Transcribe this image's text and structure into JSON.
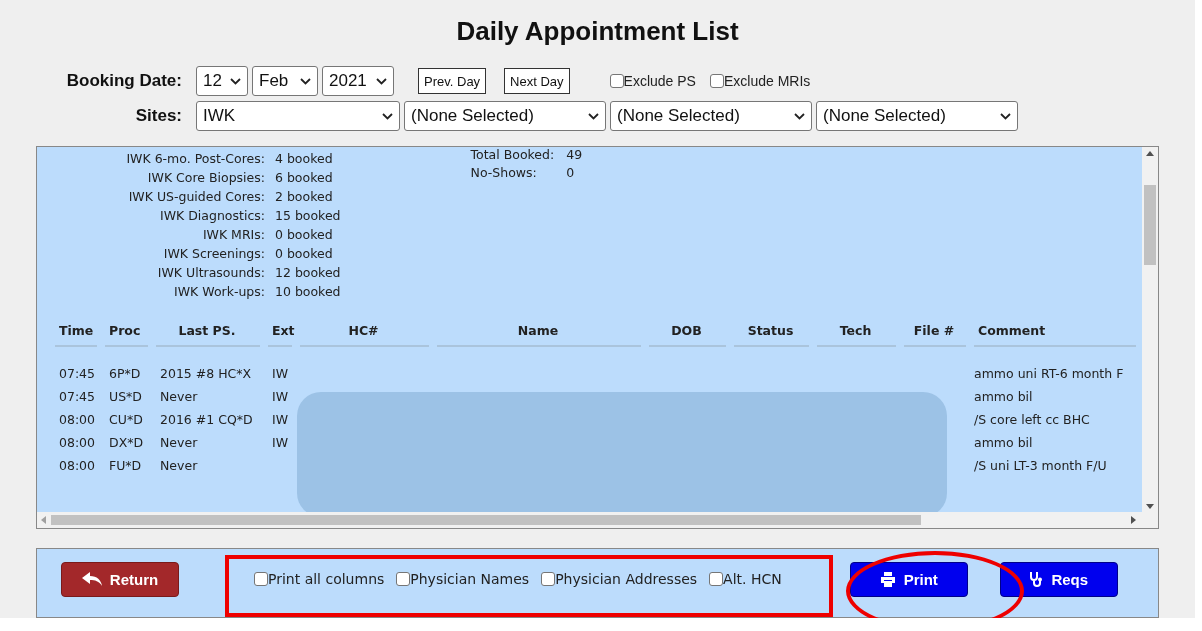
{
  "title": "Daily Appointment List",
  "booking_date": {
    "label": "Booking Date:",
    "day": "12",
    "month": "Feb",
    "year": "2021"
  },
  "day_buttons": [
    "Prev. Day",
    "Next Day"
  ],
  "filters": [
    {
      "label": "Exclude PS",
      "checked": false
    },
    {
      "label": "Exclude MRIs",
      "checked": false
    }
  ],
  "sites": {
    "label": "Sites:",
    "selects": [
      "IWK",
      "(None Selected)",
      "(None Selected)",
      "(None Selected)"
    ]
  },
  "summary": [
    {
      "label": "IWK 6-mo. Post-Cores:",
      "value": "4 booked"
    },
    {
      "label": "IWK Core Biopsies:",
      "value": "6 booked"
    },
    {
      "label": "IWK US-guided Cores:",
      "value": "2 booked"
    },
    {
      "label": "IWK Diagnostics:",
      "value": "15 booked"
    },
    {
      "label": "IWK MRIs:",
      "value": "0 booked"
    },
    {
      "label": "IWK Screenings:",
      "value": "0 booked"
    },
    {
      "label": "IWK Ultrasounds:",
      "value": "12 booked"
    },
    {
      "label": "IWK Work-ups:",
      "value": "10 booked"
    }
  ],
  "totals": [
    {
      "label": "Total Booked:",
      "value": "49"
    },
    {
      "label": "No-Shows:",
      "value": "0"
    }
  ],
  "table": {
    "columns": [
      "Time",
      "Proc",
      "Last PS.",
      "Ext",
      "HC#",
      "Name",
      "DOB",
      "Status",
      "Tech",
      "File #",
      "Comment"
    ],
    "rows": [
      {
        "time": "07:45",
        "proc": "6P*D",
        "last_ps": "2015 #8 HC*X",
        "ext": "IW",
        "comment": "ammo uni RT-6 month F"
      },
      {
        "time": "07:45",
        "proc": "US*D",
        "last_ps": "Never",
        "ext": "IW",
        "comment": "ammo bil"
      },
      {
        "time": "08:00",
        "proc": "CU*D",
        "last_ps": "2016 #1 CQ*D",
        "ext": "IW",
        "comment": "/S core left cc BHC"
      },
      {
        "time": "08:00",
        "proc": "DX*D",
        "last_ps": "Never",
        "ext": "IW",
        "comment": "ammo bil"
      },
      {
        "time": "08:00",
        "proc": "FU*D",
        "last_ps": "Never",
        "comment": "/S uni LT-3 month F/U"
      }
    ]
  },
  "footer": {
    "return_button": "Return",
    "print_options": [
      {
        "label": "Print all columns",
        "checked": false
      },
      {
        "label": "Physician Names",
        "checked": false
      },
      {
        "label": "Physician Addresses",
        "checked": false
      },
      {
        "label": "Alt. HCN",
        "checked": false
      }
    ],
    "print_button": "Print",
    "reqs_button": "Reqs"
  }
}
